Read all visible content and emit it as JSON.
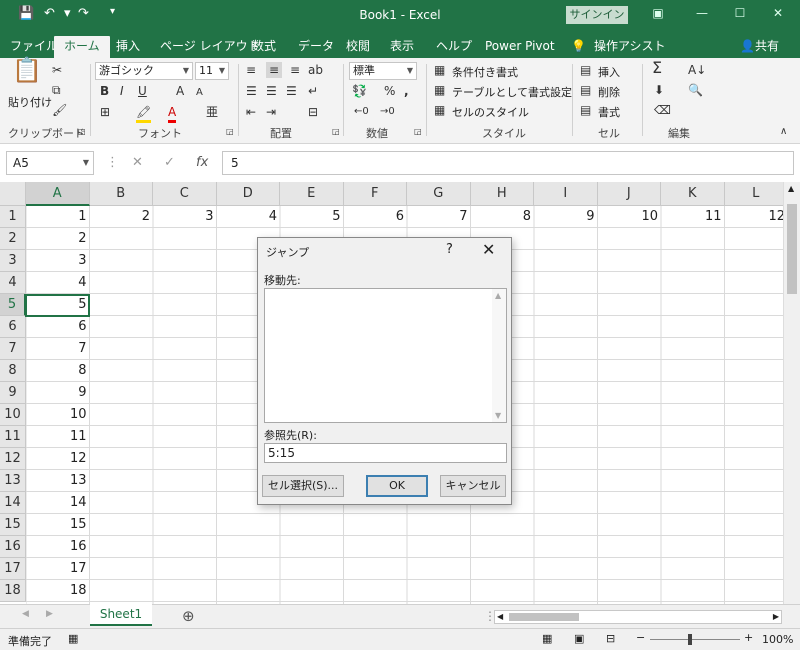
{
  "titlebar": {
    "title": "Book1  -  Excel",
    "signin": "サインイン",
    "icons": [
      "save-icon",
      "undo-icon",
      "redo-icon",
      "customize-icon"
    ]
  },
  "tabs": [
    "ファイル",
    "ホーム",
    "挿入",
    "ページ レイアウト",
    "数式",
    "データ",
    "校閲",
    "表示",
    "ヘルプ",
    "Power Pivot",
    "操作アシスト"
  ],
  "share": "共有",
  "ribbon": {
    "clipboard": {
      "paste": "貼り付け",
      "label": "クリップボード"
    },
    "font": {
      "name": "游ゴシック",
      "size": "11",
      "label": "フォント",
      "bold": "B",
      "italic": "I",
      "underline": "U",
      "grow": "A",
      "shrink": "A",
      "color": "A"
    },
    "alignment": {
      "label": "配置"
    },
    "number": {
      "format": "標準",
      "label": "数値",
      "percent": "%",
      "comma": ","
    },
    "styles": {
      "conditional": "条件付き書式",
      "table": "テーブルとして書式設定",
      "cell": "セルのスタイル",
      "label": "スタイル"
    },
    "cells": {
      "insert": "挿入",
      "delete": "削除",
      "format": "書式",
      "label": "セル"
    },
    "editing": {
      "sum": "Σ",
      "label": "編集"
    }
  },
  "formula": {
    "namebox": "A5",
    "value": "5",
    "fx": "fx"
  },
  "columns": [
    "A",
    "B",
    "C",
    "D",
    "E",
    "F",
    "G",
    "H",
    "I",
    "J",
    "K",
    "L"
  ],
  "rows": [
    "1",
    "2",
    "3",
    "4",
    "5",
    "6",
    "7",
    "8",
    "9",
    "10",
    "11",
    "12",
    "13",
    "14",
    "15",
    "16",
    "17",
    "18"
  ],
  "row1": [
    "1",
    "2",
    "3",
    "4",
    "5",
    "6",
    "7",
    "8",
    "9",
    "10",
    "11",
    "12"
  ],
  "colA": [
    "2",
    "3",
    "4",
    "5",
    "6",
    "7",
    "8",
    "9",
    "10",
    "11",
    "12",
    "13",
    "14",
    "15",
    "16",
    "17",
    "18"
  ],
  "sheet": {
    "name": "Sheet1",
    "add": "⊕"
  },
  "status": {
    "ready": "準備完了",
    "zoom": "100%"
  },
  "dialog": {
    "title": "ジャンプ",
    "help": "?",
    "close": "✕",
    "goto_label": "移動先:",
    "ref_label": "参照先(R):",
    "ref_value": "5:15",
    "special": "セル選択(S)...",
    "ok": "OK",
    "cancel": "キャンセル"
  },
  "colors": {
    "accent": "#217346"
  }
}
